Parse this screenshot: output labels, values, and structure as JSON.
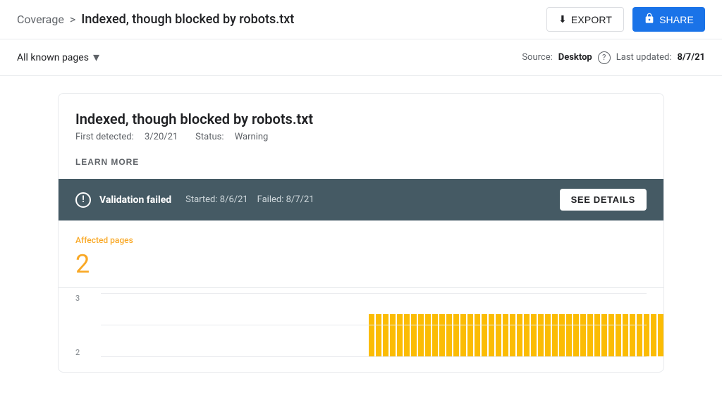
{
  "header": {
    "breadcrumb_parent": "Coverage",
    "breadcrumb_separator": ">",
    "breadcrumb_current": "Indexed, though blocked by robots.txt",
    "export_label": "EXPORT",
    "share_label": "SHARE"
  },
  "filter_bar": {
    "filter_label": "All known pages",
    "source_label": "Source:",
    "source_value": "Desktop",
    "help_icon": "?",
    "last_updated_label": "Last updated:",
    "last_updated_value": "8/7/21"
  },
  "card": {
    "title": "Indexed, though blocked by robots.txt",
    "first_detected_label": "First detected:",
    "first_detected_value": "3/20/21",
    "status_label": "Status:",
    "status_value": "Warning",
    "learn_more": "LEARN MORE"
  },
  "validation": {
    "title": "Validation failed",
    "started_label": "Started:",
    "started_value": "8/6/21",
    "failed_label": "Failed:",
    "failed_value": "8/7/21",
    "see_details": "SEE DETAILS"
  },
  "affected": {
    "label": "Affected pages",
    "count": "2"
  },
  "chart": {
    "y_labels": [
      "3",
      "2"
    ],
    "bar_height_pct": 60,
    "bars": [
      0,
      0,
      0,
      0,
      0,
      0,
      0,
      0,
      0,
      0,
      0,
      0,
      0,
      0,
      0,
      0,
      0,
      0,
      0,
      0,
      0,
      0,
      0,
      0,
      0,
      0,
      0,
      0,
      0,
      0,
      0,
      0,
      0,
      0,
      0,
      0,
      0,
      0,
      1,
      1,
      1,
      1,
      1,
      1,
      1,
      1,
      1,
      1,
      1,
      1,
      1,
      1,
      1,
      1,
      1,
      1,
      1,
      1,
      1,
      1,
      1,
      1,
      1,
      1,
      1,
      1,
      1,
      1,
      1,
      1,
      1,
      1,
      1,
      1,
      1,
      1,
      1,
      1,
      1,
      1,
      1,
      1,
      1,
      1
    ]
  },
  "icons": {
    "export_icon": "⬇",
    "share_icon": "🔒",
    "dropdown_arrow": "▾",
    "alert_icon": "!"
  }
}
